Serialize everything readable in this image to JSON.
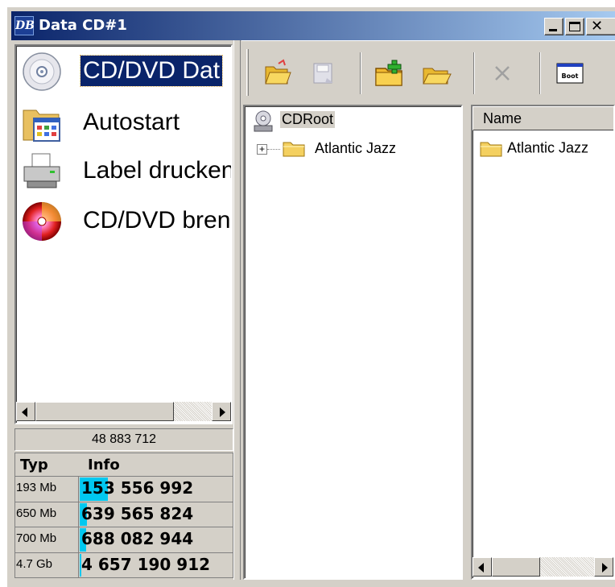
{
  "window": {
    "title": "Data CD#1",
    "icon_text": "DB"
  },
  "nav": {
    "items": [
      {
        "label": "CD/DVD Dat",
        "icon": "cd-disc-icon",
        "selected": true
      },
      {
        "label": "Autostart",
        "icon": "autostart-folder-icon",
        "selected": false
      },
      {
        "label": "Label drucken",
        "icon": "printer-icon",
        "selected": false
      },
      {
        "label": "CD/DVD brennen",
        "icon": "burn-disc-icon",
        "selected": false
      }
    ]
  },
  "status": {
    "size_counter": "48 883 712"
  },
  "media_table": {
    "col_typ": "Typ",
    "col_info": "Info",
    "rows": [
      {
        "typ": "193 Mb",
        "info": "153 556 992",
        "fill": 0.32
      },
      {
        "typ": "650 Mb",
        "info": "639 565 824",
        "fill": 0.08
      },
      {
        "typ": "700 Mb",
        "info": "688 082 944",
        "fill": 0.07
      },
      {
        "typ": "4.7 Gb",
        "info": "4 657 190 912",
        "fill": 0.01
      }
    ]
  },
  "toolbar": {
    "buttons": [
      {
        "name": "open-project-icon"
      },
      {
        "name": "save-project-icon"
      },
      {
        "name": "new-folder-icon"
      },
      {
        "name": "add-files-icon"
      },
      {
        "name": "delete-icon"
      },
      {
        "name": "boot-icon",
        "label": "Boot"
      }
    ]
  },
  "tree": {
    "root_label": "CDRoot",
    "children": [
      {
        "label": "Atlantic Jazz",
        "expander": "+"
      }
    ]
  },
  "files": {
    "column_name": "Name",
    "items": [
      {
        "name": "Atlantic Jazz"
      }
    ]
  },
  "colors": {
    "title_start": "#0a246a",
    "title_end": "#a6caf0",
    "selection": "#0a246a",
    "capacity_bar": "#00c8f0",
    "face": "#d4d0c8"
  }
}
